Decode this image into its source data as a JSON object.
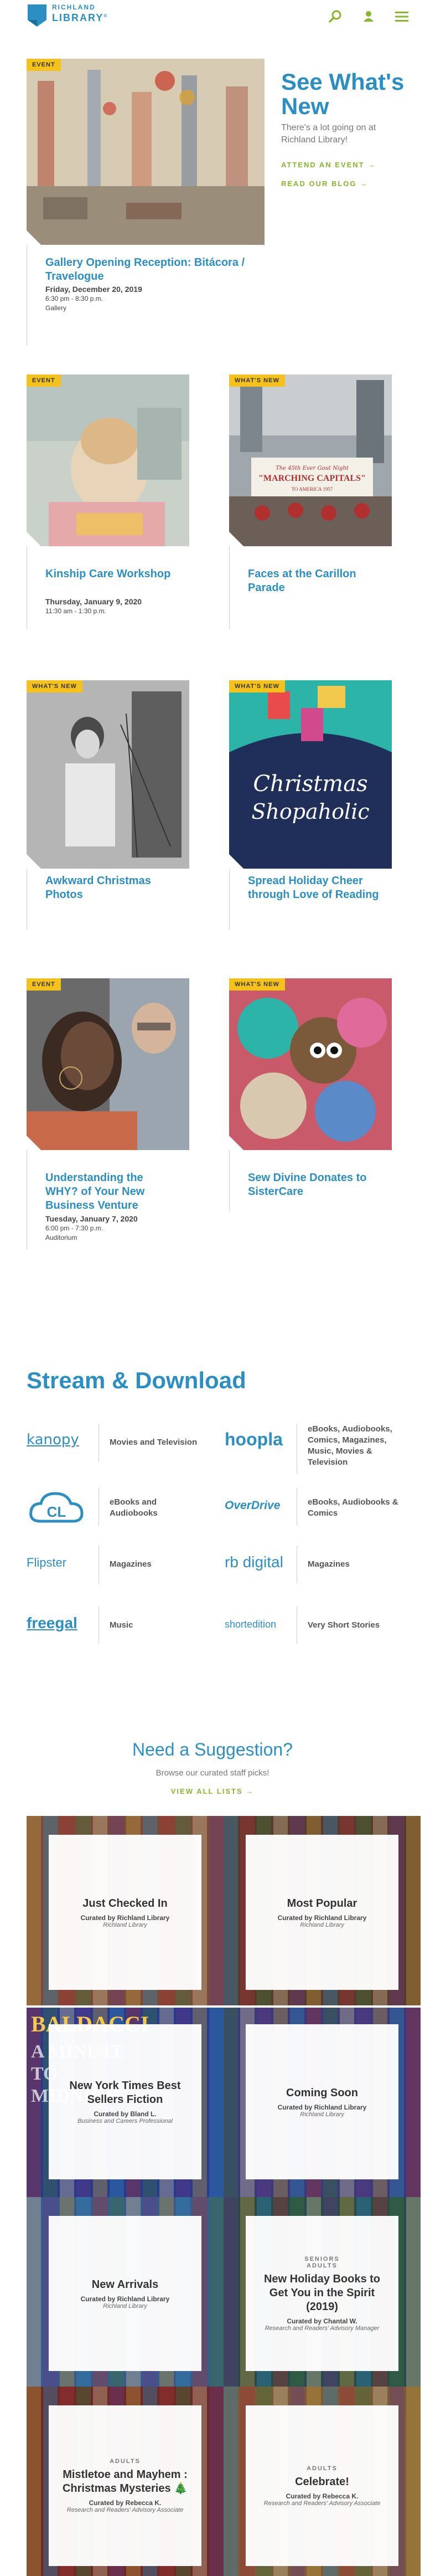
{
  "header": {
    "logo_top": "RICHLAND",
    "logo_bottom": "LIBRARY",
    "logo_mark": "®",
    "icons": [
      "search-icon",
      "user-icon",
      "menu-icon"
    ],
    "accent": "#86b62a",
    "brand": "#2b8fc4"
  },
  "whats_new": {
    "title": "See What's New",
    "subtitle": "There's a lot going on at Richland Library!",
    "attend_link": "ATTEND AN EVENT",
    "blog_link": "READ OUR BLOG",
    "arrow": "→"
  },
  "cards": [
    {
      "badge": "EVENT",
      "title": "Gallery Opening Reception: Bitácora / Travelogue",
      "date": "Friday, December 20, 2019",
      "time": "6:30 pm - 8:30 p.m.",
      "location": "Gallery"
    },
    {
      "badge": "EVENT",
      "title": "Kinship Care Workshop",
      "date": "Thursday, January 9, 2020",
      "time": "11:30 am - 1:30 p.m.",
      "location": ""
    },
    {
      "badge": "WHAT'S NEW",
      "title": "Faces at the Carillon Parade",
      "date": "",
      "time": "",
      "location": "",
      "banner_line1": "The 45th Ever Gout Night",
      "banner_line2": "\"MARCHING CAPITALS\"",
      "banner_line3": "TO AMERICA 1957"
    },
    {
      "badge": "WHAT'S NEW",
      "title": "Awkward Christmas Photos",
      "date": "",
      "time": "",
      "location": ""
    },
    {
      "badge": "WHAT'S NEW",
      "title": "Spread Holiday Cheer through Love of Reading",
      "date": "",
      "time": "",
      "location": "",
      "art_line1": "Christmas",
      "art_line2": "Shopaholic"
    },
    {
      "badge": "EVENT",
      "title": "Understanding the WHY? of Your New Business Venture",
      "date": "Tuesday, January 7, 2020",
      "time": "6:00 pm - 7:30 p.m.",
      "location": "Auditorium"
    },
    {
      "badge": "WHAT'S NEW",
      "title": "Sew Divine Donates to SisterCare",
      "date": "",
      "time": "",
      "location": ""
    }
  ],
  "stream": {
    "title": "Stream & Download",
    "services": [
      {
        "name": "kanopy",
        "desc": "Movies and Television",
        "color": "#2b8fc4"
      },
      {
        "name": "hoopla",
        "desc": "eBooks, Audiobooks, Comics, Magazines, Music, Movies & Television",
        "color": "#2b8fc4"
      },
      {
        "name": "CL",
        "desc": "eBooks and Audiobooks",
        "color": "#2b8fc4"
      },
      {
        "name": "OverDrive",
        "desc": "eBooks, Audiobooks & Comics",
        "color": "#2b8fc4"
      },
      {
        "name": "Flipster",
        "desc": "Magazines",
        "color": "#2b8fc4"
      },
      {
        "name": "rb digital",
        "desc": "Magazines",
        "color": "#2b8fc4"
      },
      {
        "name": "freegal",
        "desc": "Music",
        "color": "#2b8fc4"
      },
      {
        "name": "shortedition",
        "desc": "Very Short Stories",
        "color": "#2b8fc4"
      }
    ]
  },
  "suggestion": {
    "title": "Need a Suggestion?",
    "subtitle": "Browse our curated staff picks!",
    "link": "VIEW ALL LISTS",
    "arrow": "→",
    "lists": [
      {
        "category": "",
        "title": "Just Checked In",
        "by": "Curated by Richland Library",
        "role": "Richland Library",
        "bg": "#7a4a3a"
      },
      {
        "category": "",
        "title": "Most Popular",
        "by": "Curated by Richland Library",
        "role": "Richland Library",
        "bg": "#5a3a2e"
      },
      {
        "category": "",
        "title": "New York Times Best Sellers Fiction",
        "by": "Curated by Bland L.",
        "role": "Business and Careers Professional",
        "bg": "#2a3a8a",
        "cover_text": "BALDACCI",
        "cover_text2": "A MINUTE TO MIDNIGHT"
      },
      {
        "category": "",
        "title": "Coming Soon",
        "by": "Curated by Richland Library",
        "role": "Richland Library",
        "bg": "#3a3a7a"
      },
      {
        "category": "",
        "title": "New Arrivals",
        "by": "Curated by Richland Library",
        "role": "Richland Library",
        "bg": "#3a5a8a"
      },
      {
        "category": "SENIORS\nADULTS",
        "title": "New Holiday Books to Get You in the Spirit (2019)",
        "by": "Curated by Chantal W.",
        "role": "Research and Readers' Advisory Manager",
        "bg": "#2a4a4a"
      },
      {
        "category": "ADULTS",
        "title": "Mistletoe and Mayhem : Christmas Mysteries 🎄",
        "by": "Curated by Rebecca K.",
        "role": "Research and Readers' Advisory Associate",
        "bg": "#6a2a2a"
      },
      {
        "category": "ADULTS",
        "title": "Celebrate!",
        "by": "Curated by Rebecca K.",
        "role": "Research and Readers' Advisory Associate",
        "bg": "#7a5a3a"
      }
    ]
  }
}
